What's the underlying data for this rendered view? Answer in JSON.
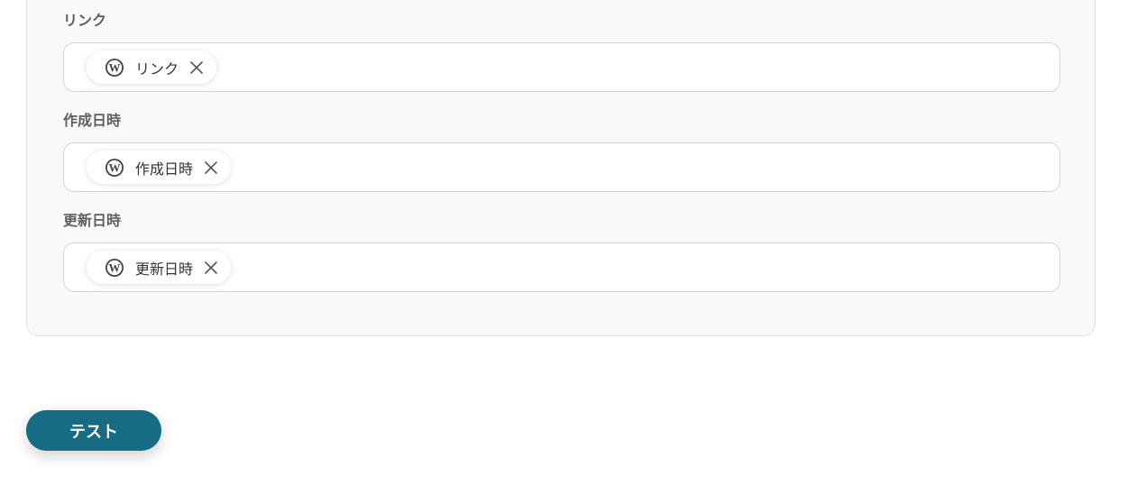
{
  "fields": [
    {
      "label": "リンク",
      "chip": {
        "icon": "wordpress-icon",
        "label": "リンク"
      }
    },
    {
      "label": "作成日時",
      "chip": {
        "icon": "wordpress-icon",
        "label": "作成日時"
      }
    },
    {
      "label": "更新日時",
      "chip": {
        "icon": "wordpress-icon",
        "label": "更新日時"
      }
    }
  ],
  "actions": {
    "test_label": "テスト"
  },
  "colors": {
    "accent": "#176c84",
    "panel_background": "#f9f9f9",
    "chip_text": "#333333",
    "label_text": "#5f5f5f"
  }
}
